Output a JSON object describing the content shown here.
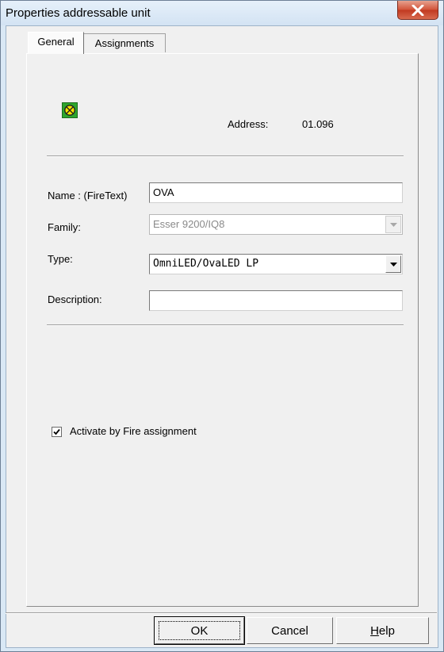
{
  "window": {
    "title": "Properties addressable unit",
    "close_icon": "close-icon"
  },
  "tabs": [
    {
      "label": "General",
      "selected": true
    },
    {
      "label": "Assignments",
      "selected": false
    }
  ],
  "device": {
    "icon": "device-status-icon",
    "icon_color": "#2ea52e",
    "address_label": "Address:",
    "address_value": "01.096"
  },
  "form": {
    "name_label": "Name : (FireText)",
    "name_value": "OVA",
    "family_label": "Family:",
    "family_value": "Esser 9200/IQ8",
    "type_label": "Type:",
    "type_value": "OmniLED/OvaLED LP",
    "description_label": "Description:",
    "description_value": ""
  },
  "options": {
    "activate_fire_label": "Activate by Fire assignment",
    "activate_fire_checked": true
  },
  "buttons": {
    "ok": "OK",
    "cancel": "Cancel",
    "help_prefix": "H",
    "help_rest": "elp"
  }
}
